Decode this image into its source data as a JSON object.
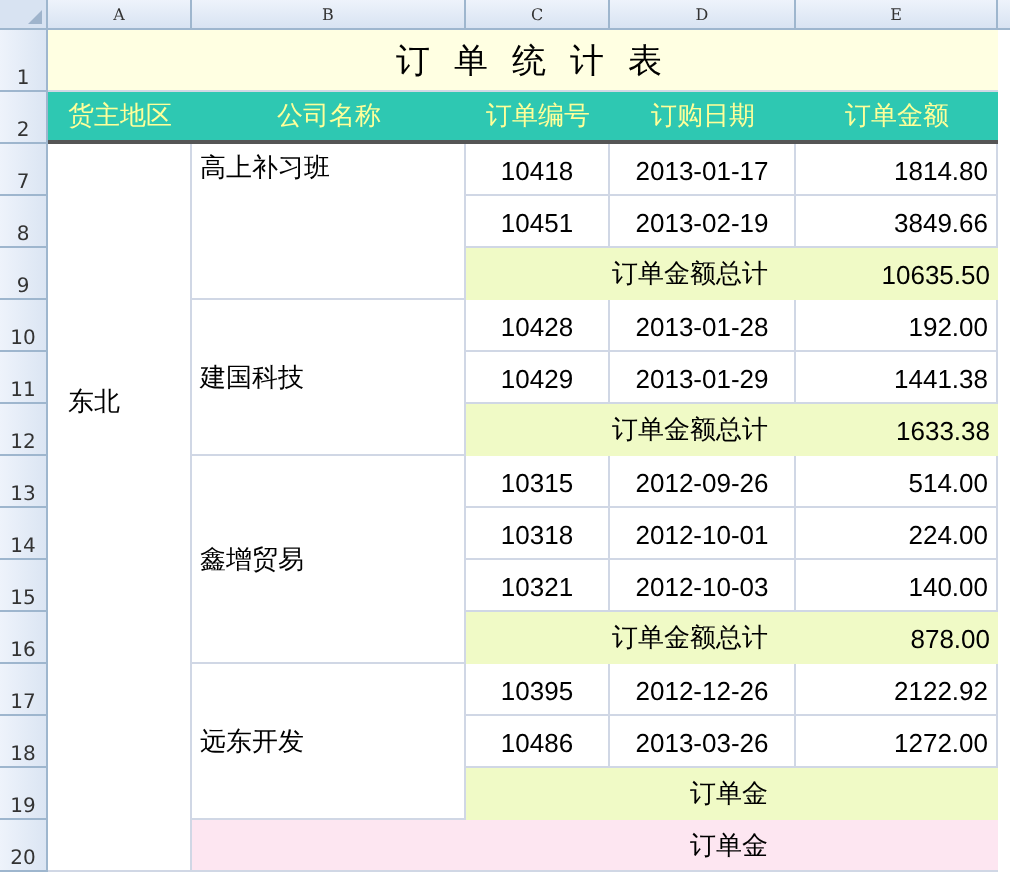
{
  "sheet": {
    "column_headers": [
      "A",
      "B",
      "C",
      "D",
      "E"
    ],
    "row_numbers": [
      "1",
      "2",
      "7",
      "8",
      "9",
      "10",
      "11",
      "12",
      "13",
      "14",
      "15",
      "16",
      "17",
      "18",
      "19",
      "20"
    ],
    "title": "订单统计表",
    "header": [
      "货主地区",
      "公司名称",
      "订单编号",
      "订购日期",
      "订单金额"
    ],
    "regions": [
      {
        "name": "东北",
        "companies": [
          {
            "name": "高上补习班",
            "orders": [
              {
                "id": "10418",
                "date": "2013-01-17",
                "amount": "1814.80"
              },
              {
                "id": "10451",
                "date": "2013-02-19",
                "amount": "3849.66"
              }
            ],
            "subtotal": {
              "label": "订单金额总计",
              "amount": "10635.50"
            }
          },
          {
            "name": "建国科技",
            "orders": [
              {
                "id": "10428",
                "date": "2013-01-28",
                "amount": "192.00"
              },
              {
                "id": "10429",
                "date": "2013-01-29",
                "amount": "1441.38"
              }
            ],
            "subtotal": {
              "label": "订单金额总计",
              "amount": "1633.38"
            }
          },
          {
            "name": "鑫增贸易",
            "orders": [
              {
                "id": "10315",
                "date": "2012-09-26",
                "amount": "514.00"
              },
              {
                "id": "10318",
                "date": "2012-10-01",
                "amount": "224.00"
              },
              {
                "id": "10321",
                "date": "2012-10-03",
                "amount": "140.00"
              }
            ],
            "subtotal": {
              "label": "订单金额总计",
              "amount": "878.00"
            }
          },
          {
            "name": "远东开发",
            "orders": [
              {
                "id": "10395",
                "date": "2012-12-26",
                "amount": "2122.92"
              },
              {
                "id": "10486",
                "date": "2013-03-26",
                "amount": "1272.00"
              }
            ],
            "subtotal": {
              "label": "订单金"
            }
          }
        ],
        "total": {
          "label": "订单金"
        }
      }
    ]
  }
}
